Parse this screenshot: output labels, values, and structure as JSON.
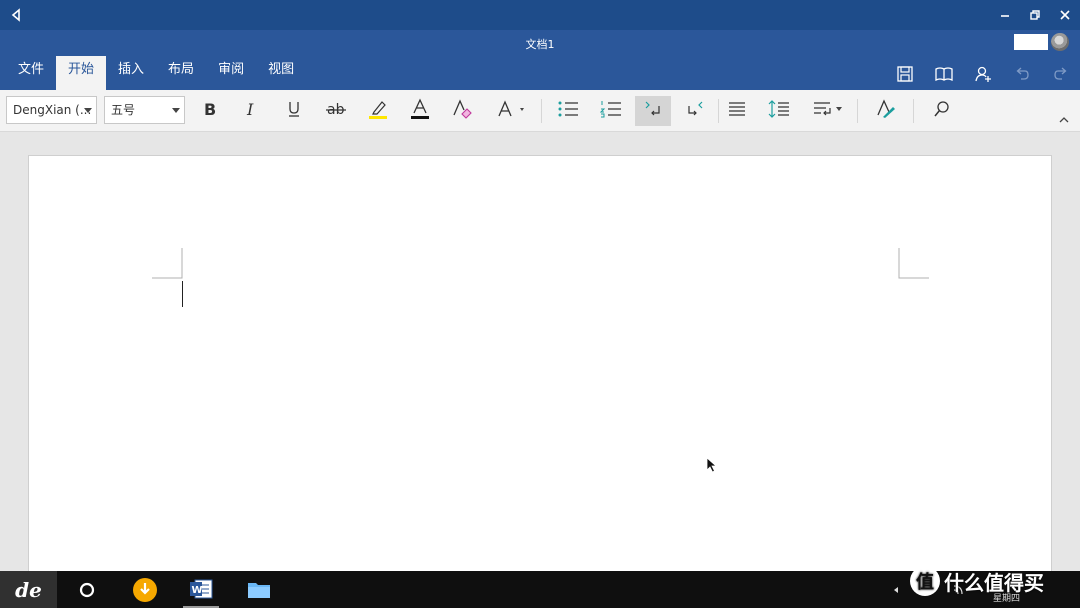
{
  "app": {
    "doc_title": "文档1"
  },
  "tabs": [
    {
      "label": "文件",
      "active": false
    },
    {
      "label": "开始",
      "active": true
    },
    {
      "label": "插入",
      "active": false
    },
    {
      "label": "布局",
      "active": false
    },
    {
      "label": "审阅",
      "active": false
    },
    {
      "label": "视图",
      "active": false
    }
  ],
  "toolbar": {
    "font_name": "DengXian (...",
    "font_size": "五号"
  },
  "taskbar": {
    "start_label": "de",
    "day": "星期四"
  },
  "watermark": {
    "circle": "值",
    "text": "什么值得买"
  },
  "colors": {
    "titlebar": "#1e4c8a",
    "ribbon": "#2b579a",
    "toolbar": "#f3f3f3",
    "highlight_yellow": "#ffe600",
    "accent_teal": "#1b9e9e"
  },
  "icons": [
    "back-icon",
    "minimize-icon",
    "restore-icon",
    "close-icon",
    "save-icon",
    "read-mode-icon",
    "share-icon",
    "undo-icon",
    "redo-icon",
    "bold-icon",
    "italic-icon",
    "underline-icon",
    "strikethrough-icon",
    "highlight-icon",
    "font-color-icon",
    "clear-format-icon",
    "text-effects-icon",
    "bullets-icon",
    "numbering-icon",
    "indent-icon",
    "outdent-icon",
    "align-icon",
    "line-spacing-icon",
    "paragraph-icon",
    "styles-icon",
    "find-icon",
    "collapse-ribbon-icon"
  ]
}
